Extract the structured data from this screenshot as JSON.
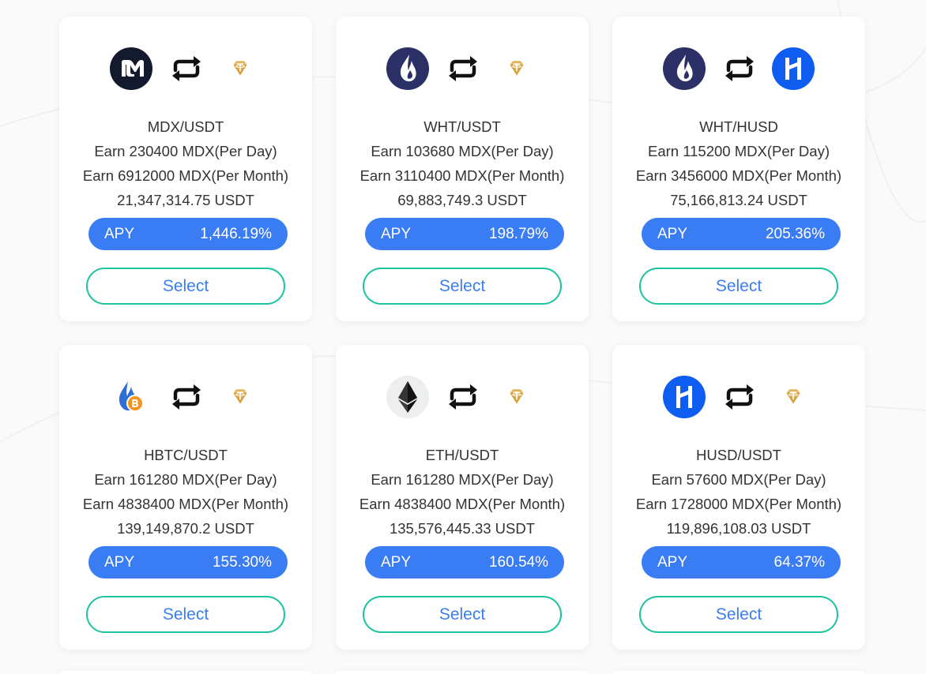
{
  "colors": {
    "accent": "#3a7cf3",
    "select_border": "#20c3a0",
    "text": "#333333",
    "usdt_gold": "#e2b45a",
    "husd_blue": "#0f5cf0",
    "wht_navy": "#2b3166",
    "mdx_dark": "#141a2e"
  },
  "pools": [
    {
      "pair": "MDX/USDT",
      "earn_day": "Earn 230400 MDX(Per Day)",
      "earn_month": "Earn 6912000 MDX(Per Month)",
      "tvl": "21,347,314.75 USDT",
      "apy_label": "APY",
      "apy_value": "1,446.19%",
      "select_label": "Select",
      "token_a_icon": "mdx-icon",
      "token_b_icon": "usdt-icon"
    },
    {
      "pair": "WHT/USDT",
      "earn_day": "Earn 103680 MDX(Per Day)",
      "earn_month": "Earn 3110400 MDX(Per Month)",
      "tvl": "69,883,749.3 USDT",
      "apy_label": "APY",
      "apy_value": "198.79%",
      "select_label": "Select",
      "token_a_icon": "wht-icon",
      "token_b_icon": "usdt-icon"
    },
    {
      "pair": "WHT/HUSD",
      "earn_day": "Earn 115200 MDX(Per Day)",
      "earn_month": "Earn 3456000 MDX(Per Month)",
      "tvl": "75,166,813.24 USDT",
      "apy_label": "APY",
      "apy_value": "205.36%",
      "select_label": "Select",
      "token_a_icon": "wht-icon",
      "token_b_icon": "husd-icon"
    },
    {
      "pair": "HBTC/USDT",
      "earn_day": "Earn 161280 MDX(Per Day)",
      "earn_month": "Earn 4838400 MDX(Per Month)",
      "tvl": "139,149,870.2 USDT",
      "apy_label": "APY",
      "apy_value": "155.30%",
      "select_label": "Select",
      "token_a_icon": "hbtc-icon",
      "token_b_icon": "usdt-icon"
    },
    {
      "pair": "ETH/USDT",
      "earn_day": "Earn 161280 MDX(Per Day)",
      "earn_month": "Earn 4838400 MDX(Per Month)",
      "tvl": "135,576,445.33 USDT",
      "apy_label": "APY",
      "apy_value": "160.54%",
      "select_label": "Select",
      "token_a_icon": "eth-icon",
      "token_b_icon": "usdt-icon"
    },
    {
      "pair": "HUSD/USDT",
      "earn_day": "Earn 57600 MDX(Per Day)",
      "earn_month": "Earn 1728000 MDX(Per Month)",
      "tvl": "119,896,108.03 USDT",
      "apy_label": "APY",
      "apy_value": "64.37%",
      "select_label": "Select",
      "token_a_icon": "husd-icon",
      "token_b_icon": "usdt-icon"
    }
  ]
}
